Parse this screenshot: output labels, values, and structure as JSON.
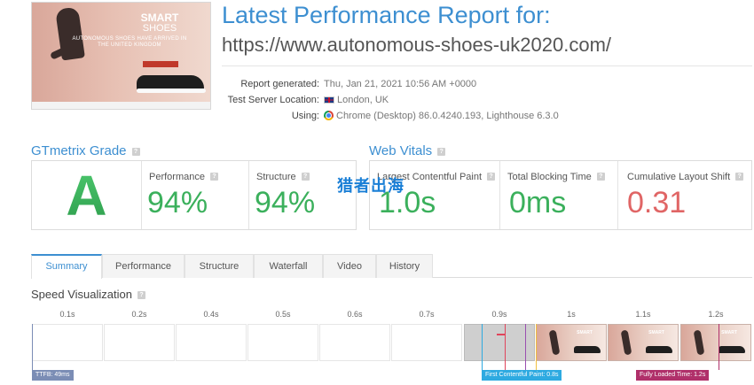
{
  "screenshot": {
    "brand_line1": "SMART",
    "brand_line2": "SHOES",
    "tagline": "AUTONOMOUS SHOES HAVE ARRIVED IN THE UNITED KINGDOM"
  },
  "header": {
    "title": "Latest Performance Report for:",
    "url": "https://www.autonomous-shoes-uk2020.com/"
  },
  "meta": {
    "report_generated_label": "Report generated:",
    "report_generated_value": "Thu, Jan 21, 2021 10:56 AM +0000",
    "server_label": "Test Server Location:",
    "server_value": "London, UK",
    "using_label": "Using:",
    "using_value": "Chrome (Desktop) 86.0.4240.193, Lighthouse 6.3.0"
  },
  "grade": {
    "heading": "GTmetrix Grade",
    "letter": "A",
    "performance_label": "Performance",
    "performance_value": "94%",
    "structure_label": "Structure",
    "structure_value": "94%"
  },
  "vitals": {
    "heading": "Web Vitals",
    "lcp_label": "Largest Contentful Paint",
    "lcp_value": "1.0s",
    "tbt_label": "Total Blocking Time",
    "tbt_value": "0ms",
    "cls_label": "Cumulative Layout Shift",
    "cls_value": "0.31"
  },
  "watermark": "猎者出海",
  "tabs": [
    "Summary",
    "Performance",
    "Structure",
    "Waterfall",
    "Video",
    "History"
  ],
  "speed": {
    "heading": "Speed Visualization",
    "frame_labels": [
      "0.1s",
      "0.2s",
      "0.4s",
      "0.5s",
      "0.6s",
      "0.7s",
      "0.9s",
      "1s",
      "1.1s",
      "1.2s"
    ],
    "markers": {
      "ttfb": "TTFB: 49ms",
      "fcp": "First Contentful Paint: 0.8s",
      "flt": "Fully Loaded Time: 1.2s"
    }
  },
  "colors": {
    "accent_blue": "#3d8fd1",
    "grade_green": "#3bb05c",
    "cls_red": "#e06565",
    "ttfb_marker": "#7b8db5",
    "fcp_marker": "#2eaae1",
    "flt_marker": "#b0306a"
  },
  "icons": {
    "help": "question-mark-icon",
    "flag": "uk-flag-icon",
    "browser": "chrome-icon"
  }
}
